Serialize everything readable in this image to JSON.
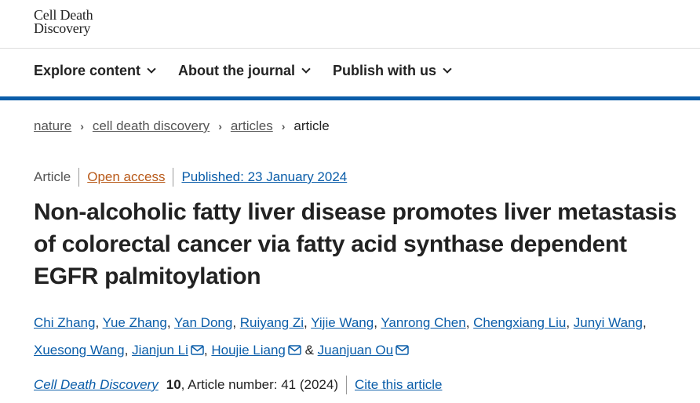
{
  "logo": {
    "line1": "Cell Death",
    "line2": "Discovery"
  },
  "nav": {
    "items": [
      {
        "label": "Explore content"
      },
      {
        "label": "About the journal"
      },
      {
        "label": "Publish with us"
      }
    ]
  },
  "breadcrumb": {
    "items": [
      "nature",
      "cell death discovery",
      "articles"
    ],
    "current": "article"
  },
  "meta": {
    "type": "Article",
    "access": "Open access",
    "published": "Published: 23 January 2024"
  },
  "title": "Non-alcoholic fatty liver disease promotes liver metastasis of colorectal cancer via fatty acid synthase dependent EGFR palmitoylation",
  "authors": [
    {
      "name": "Chi Zhang"
    },
    {
      "name": "Yue Zhang"
    },
    {
      "name": "Yan Dong"
    },
    {
      "name": "Ruiyang Zi"
    },
    {
      "name": "Yijie Wang"
    },
    {
      "name": "Yanrong Chen"
    },
    {
      "name": "Chengxiang Liu"
    },
    {
      "name": "Junyi Wang"
    },
    {
      "name": "Xuesong Wang"
    },
    {
      "name": "Jianjun Li"
    },
    {
      "name": "Houjie Liang"
    },
    {
      "name": "Juanjuan Ou"
    }
  ],
  "author_separator": ",",
  "author_last_separator": "&",
  "citation": {
    "journal": "Cell Death Discovery",
    "volume": "10",
    "details": ", Article number: 41 (2024)",
    "cite_label": "Cite this article"
  },
  "colors": {
    "link": "#0a5da9",
    "open_access": "#b95b1b",
    "band": "#0a5da9"
  },
  "icons": {
    "nav_dropdown": "chevron-down-icon",
    "author_contact": "mail-icon"
  }
}
